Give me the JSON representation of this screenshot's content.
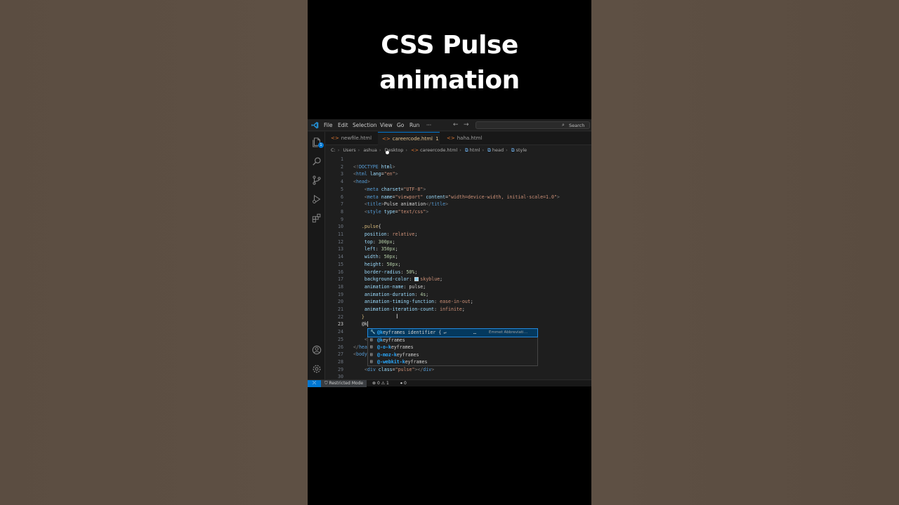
{
  "headline": {
    "line1": "CSS Pulse",
    "line2": "animation"
  },
  "titlebar": {
    "menu": [
      "File",
      "Edit",
      "Selection",
      "View",
      "Go",
      "Run",
      "···"
    ],
    "back_icon": "arrow-left-icon",
    "forward_icon": "arrow-right-icon",
    "search_label": "Search"
  },
  "activity": {
    "items": [
      "explorer-icon",
      "search-icon",
      "source-control-icon",
      "run-debug-icon",
      "extensions-icon",
      "account-icon",
      "settings-gear-icon"
    ],
    "explorer_badge": "1"
  },
  "tabs": [
    {
      "label": "newfile.html",
      "active": false
    },
    {
      "label": "careercode.html",
      "marker": "1",
      "active": true,
      "modified": true
    },
    {
      "label": "haha.html",
      "active": false
    }
  ],
  "breadcrumbs": [
    "C:",
    "Users",
    "ashua",
    "Desktop",
    "careercode.html",
    "html",
    "head",
    "style"
  ],
  "editor": {
    "lines": [
      {
        "n": "1",
        "tokens": []
      },
      {
        "n": "2",
        "tokens": [
          [
            "t-br",
            "<!"
          ],
          [
            "t-tag",
            "DOCTYPE"
          ],
          [
            "t-txt",
            " "
          ],
          [
            "t-attr",
            "html"
          ],
          [
            "t-br",
            ">"
          ]
        ]
      },
      {
        "n": "3",
        "tokens": [
          [
            "t-br",
            "<"
          ],
          [
            "t-tag",
            "html"
          ],
          [
            "t-txt",
            " "
          ],
          [
            "t-attr",
            "lang"
          ],
          [
            "t-pun",
            "="
          ],
          [
            "t-str",
            "\"en\""
          ],
          [
            "t-br",
            ">"
          ]
        ]
      },
      {
        "n": "4",
        "tokens": [
          [
            "t-br",
            "<"
          ],
          [
            "t-tag",
            "head"
          ],
          [
            "t-br",
            ">"
          ]
        ]
      },
      {
        "n": "5",
        "indent": "    ",
        "tokens": [
          [
            "t-br",
            "<"
          ],
          [
            "t-tag",
            "meta"
          ],
          [
            "t-txt",
            " "
          ],
          [
            "t-attr",
            "charset"
          ],
          [
            "t-pun",
            "="
          ],
          [
            "t-str",
            "\"UTF-8\""
          ],
          [
            "t-br",
            ">"
          ]
        ]
      },
      {
        "n": "6",
        "indent": "    ",
        "tokens": [
          [
            "t-br",
            "<"
          ],
          [
            "t-tag",
            "meta"
          ],
          [
            "t-txt",
            " "
          ],
          [
            "t-attr",
            "name"
          ],
          [
            "t-pun",
            "="
          ],
          [
            "t-str",
            "\"viewport\""
          ],
          [
            "t-txt",
            " "
          ],
          [
            "t-attr",
            "content"
          ],
          [
            "t-pun",
            "="
          ],
          [
            "t-str",
            "\"width=device-width, initial-scale=1.0\""
          ],
          [
            "t-br",
            ">"
          ]
        ]
      },
      {
        "n": "7",
        "indent": "    ",
        "tokens": [
          [
            "t-br",
            "<"
          ],
          [
            "t-tag",
            "title"
          ],
          [
            "t-br",
            ">"
          ],
          [
            "t-txt",
            "Pulse animation"
          ],
          [
            "t-br",
            "</"
          ],
          [
            "t-tag",
            "title"
          ],
          [
            "t-br",
            ">"
          ]
        ]
      },
      {
        "n": "8",
        "indent": "    ",
        "tokens": [
          [
            "t-br",
            "<"
          ],
          [
            "t-tag",
            "style"
          ],
          [
            "t-txt",
            " "
          ],
          [
            "t-attr",
            "type"
          ],
          [
            "t-pun",
            "="
          ],
          [
            "t-str",
            "\"text/css\""
          ],
          [
            "t-br",
            ">"
          ]
        ]
      },
      {
        "n": "9",
        "tokens": []
      },
      {
        "n": "10",
        "indent": "   ",
        "tokens": [
          [
            "t-sel",
            ".pulse"
          ],
          [
            "t-pun",
            "{"
          ]
        ]
      },
      {
        "n": "11",
        "indent": "    ",
        "tokens": [
          [
            "t-prop",
            "position"
          ],
          [
            "t-pun",
            ": "
          ],
          [
            "t-val",
            "relative"
          ],
          [
            "t-pun",
            ";"
          ]
        ]
      },
      {
        "n": "12",
        "indent": "    ",
        "tokens": [
          [
            "t-prop",
            "top"
          ],
          [
            "t-pun",
            ": "
          ],
          [
            "t-num",
            "300px"
          ],
          [
            "t-pun",
            ";"
          ]
        ]
      },
      {
        "n": "13",
        "indent": "    ",
        "tokens": [
          [
            "t-prop",
            "left"
          ],
          [
            "t-pun",
            ": "
          ],
          [
            "t-num",
            "350px"
          ],
          [
            "t-pun",
            ";"
          ]
        ]
      },
      {
        "n": "14",
        "indent": "    ",
        "tokens": [
          [
            "t-prop",
            "width"
          ],
          [
            "t-pun",
            ": "
          ],
          [
            "t-num",
            "50px"
          ],
          [
            "t-pun",
            ";"
          ]
        ]
      },
      {
        "n": "15",
        "indent": "    ",
        "tokens": [
          [
            "t-prop",
            "height"
          ],
          [
            "t-pun",
            ": "
          ],
          [
            "t-num",
            "50px"
          ],
          [
            "t-pun",
            ";"
          ]
        ]
      },
      {
        "n": "16",
        "indent": "    ",
        "tokens": [
          [
            "t-prop",
            "border-radius"
          ],
          [
            "t-pun",
            ": "
          ],
          [
            "t-num",
            "50%"
          ],
          [
            "t-pun",
            ";"
          ]
        ]
      },
      {
        "n": "17",
        "indent": "    ",
        "swatch": true,
        "tokens": [
          [
            "t-prop",
            "background-color"
          ],
          [
            "t-pun",
            ": "
          ],
          [
            "swatch",
            ""
          ],
          [
            "t-val",
            "skyblue"
          ],
          [
            "t-pun",
            ";"
          ]
        ]
      },
      {
        "n": "18",
        "indent": "    ",
        "tokens": [
          [
            "t-prop",
            "animation-name"
          ],
          [
            "t-pun",
            ": pulse;"
          ]
        ]
      },
      {
        "n": "19",
        "indent": "    ",
        "tokens": [
          [
            "t-prop",
            "animation-duration"
          ],
          [
            "t-pun",
            ": "
          ],
          [
            "t-num",
            "4s"
          ],
          [
            "t-pun",
            ";"
          ]
        ]
      },
      {
        "n": "20",
        "indent": "    ",
        "tokens": [
          [
            "t-prop",
            "animation-timing-function"
          ],
          [
            "t-pun",
            ": "
          ],
          [
            "t-val",
            "ease-in-out"
          ],
          [
            "t-pun",
            ";"
          ]
        ]
      },
      {
        "n": "21",
        "indent": "    ",
        "tokens": [
          [
            "t-prop",
            "animation-iteration-count"
          ],
          [
            "t-pun",
            ": "
          ],
          [
            "t-val",
            "infinite"
          ],
          [
            "t-pun",
            ";"
          ]
        ]
      },
      {
        "n": "22",
        "indent": "   ",
        "tokens": [
          [
            "t-sel",
            "}"
          ]
        ]
      },
      {
        "n": "23",
        "indent": "   ",
        "current": true,
        "tokens": [
          [
            "t-txt",
            "@k"
          ]
        ]
      },
      {
        "n": "24",
        "tokens": []
      },
      {
        "n": "25",
        "indent": "    ",
        "tokens": [
          [
            "t-br",
            "<"
          ]
        ]
      },
      {
        "n": "26",
        "tokens": [
          [
            "t-br",
            "</"
          ],
          [
            "t-tag",
            "hea"
          ]
        ]
      },
      {
        "n": "27",
        "tokens": [
          [
            "t-br",
            "<"
          ],
          [
            "t-tag",
            "body"
          ]
        ]
      },
      {
        "n": "28",
        "tokens": []
      },
      {
        "n": "29",
        "indent": "    ",
        "tokens": [
          [
            "t-br",
            "<"
          ],
          [
            "t-tag",
            "div"
          ],
          [
            "t-txt",
            " "
          ],
          [
            "t-attr",
            "class"
          ],
          [
            "t-pun",
            "="
          ],
          [
            "t-str",
            "\"pulse\""
          ],
          [
            "t-br",
            ">"
          ],
          [
            "t-br",
            "</"
          ],
          [
            "t-tag",
            "div"
          ],
          [
            "t-br",
            ">"
          ]
        ]
      },
      {
        "n": "30",
        "tokens": []
      }
    ]
  },
  "suggestions": [
    {
      "icon": "wrench-icon",
      "prefix": "@k",
      "rest": "eyframes identifier {",
      "tail": "↵",
      "more": "…",
      "detail": "Emmet Abbreviati…",
      "selected": true
    },
    {
      "icon": "snippet-icon",
      "prefix": "@k",
      "rest": "eyframes",
      "selected": false
    },
    {
      "icon": "snippet-icon",
      "prefix": "@-o-k",
      "rest": "eyframes",
      "selected": false
    },
    {
      "icon": "snippet-icon",
      "prefix": "@-moz-k",
      "rest": "eyframes",
      "selected": false
    },
    {
      "icon": "snippet-icon",
      "prefix": "@-webkit-k",
      "rest": "eyframes",
      "selected": false
    }
  ],
  "statusbar": {
    "remote_icon": "remote-icon",
    "restricted": "Restricted Mode",
    "errors": "0",
    "warnings": "1",
    "ports": "0"
  },
  "colors": {
    "accent": "#0078d4",
    "swatch": "#87ceeb",
    "editor_bg": "#1e1e1e"
  }
}
